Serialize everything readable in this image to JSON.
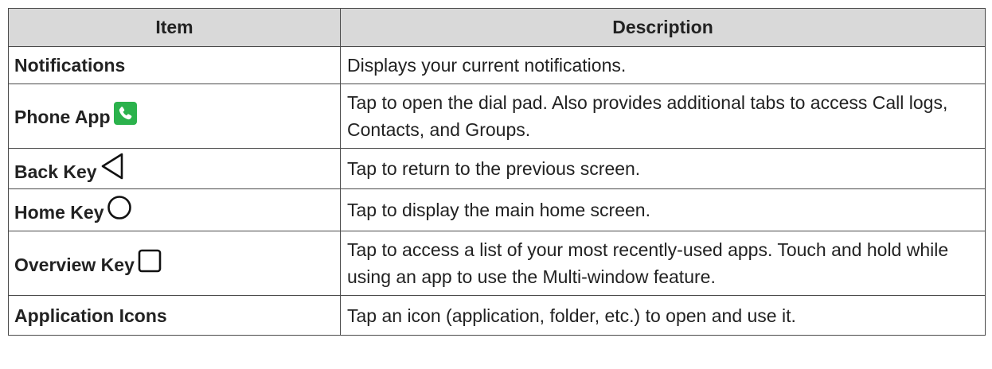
{
  "table": {
    "headers": {
      "item": "Item",
      "description": "Description"
    },
    "rows": [
      {
        "item": "Notifications",
        "description": "Displays your current notifications."
      },
      {
        "item": "Phone App",
        "icon": "phone-app-icon",
        "description": "Tap to open the dial pad. Also provides additional tabs to access Call logs, Contacts, and Groups."
      },
      {
        "item": "Back Key",
        "icon": "back-key-icon",
        "description": "Tap to return to the previous screen."
      },
      {
        "item": "Home Key",
        "icon": "home-key-icon",
        "description": "Tap to display the main home screen."
      },
      {
        "item": "Overview Key",
        "icon": "overview-key-icon",
        "description": "Tap to access a list of your most recently-used apps. Touch and hold while using an app to use the Multi-window feature."
      },
      {
        "item": "Application Icons",
        "description": "Tap an icon (application, folder, etc.) to open and use it."
      }
    ]
  },
  "colors": {
    "header_bg": "#d9d9d9",
    "border": "#4a4a4a",
    "text": "#222222",
    "phone_icon_green": "#2bb24c"
  }
}
